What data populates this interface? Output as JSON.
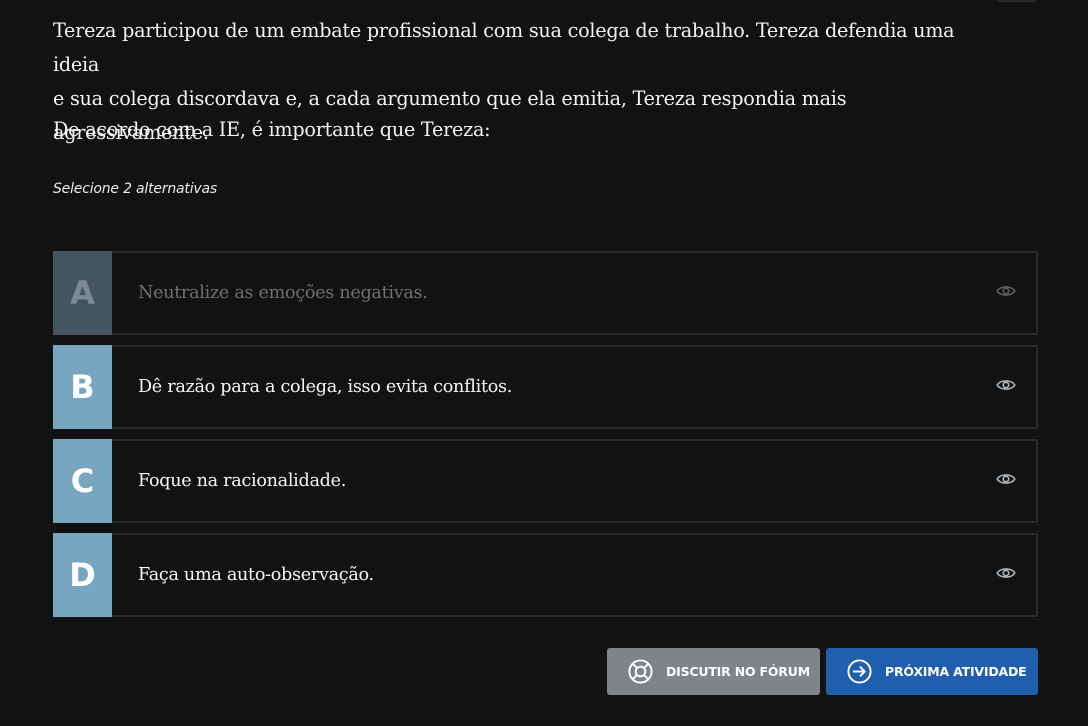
{
  "question": {
    "line1": "Tereza participou de um embate profissional com sua colega de trabalho. Tereza defendia uma ideia",
    "line2": "e sua colega discordava e, a cada argumento que ela emitia, Tereza respondia mais agressivamente.",
    "prompt": "De acordo com a IE, é importante que Tereza:",
    "instruction": "Selecione 2 alternativas"
  },
  "options": [
    {
      "letter": "A",
      "text": "Neutralize as emoções negativas.",
      "state": "eliminated"
    },
    {
      "letter": "B",
      "text": "Dê razão para a colega, isso evita conflitos.",
      "state": "normal"
    },
    {
      "letter": "C",
      "text": "Foque na racionalidade.",
      "state": "normal"
    },
    {
      "letter": "D",
      "text": "Faça uma auto-observação.",
      "state": "normal"
    }
  ],
  "icons": {
    "option_toggle": "eye-icon",
    "forum": "lifebuoy-icon",
    "next": "arrow-circle-right-icon"
  },
  "buttons": {
    "forum_label": "DISCUTIR NO FÓRUM",
    "next_label": "PRÓXIMA ATIVIDADE"
  },
  "colors": {
    "background": "#121212",
    "letter_box": "#78a6c0",
    "letter_box_eliminated": "#43555f",
    "forum_button": "#7f8489",
    "next_button": "#1f5fae"
  }
}
